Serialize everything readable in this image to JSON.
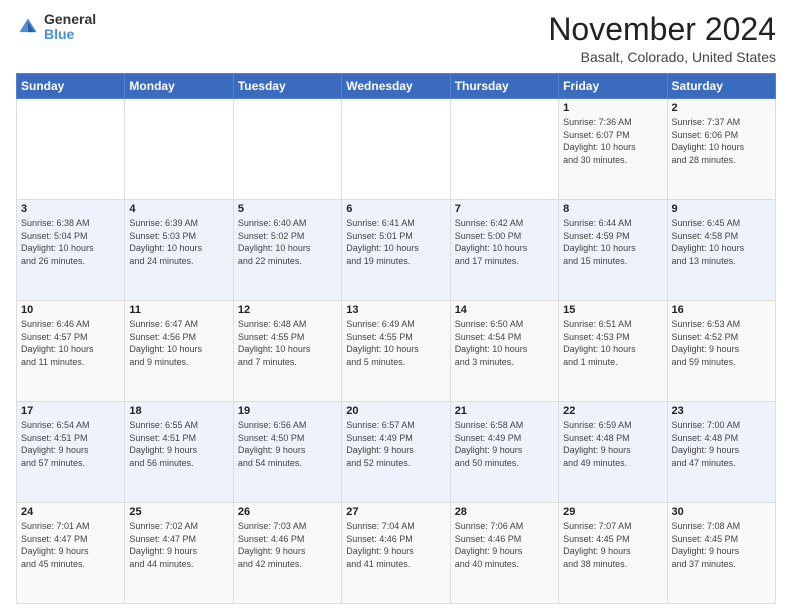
{
  "logo": {
    "general": "General",
    "blue": "Blue"
  },
  "title": "November 2024",
  "location": "Basalt, Colorado, United States",
  "days_of_week": [
    "Sunday",
    "Monday",
    "Tuesday",
    "Wednesday",
    "Thursday",
    "Friday",
    "Saturday"
  ],
  "weeks": [
    [
      {
        "day": "",
        "detail": ""
      },
      {
        "day": "",
        "detail": ""
      },
      {
        "day": "",
        "detail": ""
      },
      {
        "day": "",
        "detail": ""
      },
      {
        "day": "",
        "detail": ""
      },
      {
        "day": "1",
        "detail": "Sunrise: 7:36 AM\nSunset: 6:07 PM\nDaylight: 10 hours\nand 30 minutes."
      },
      {
        "day": "2",
        "detail": "Sunrise: 7:37 AM\nSunset: 6:06 PM\nDaylight: 10 hours\nand 28 minutes."
      }
    ],
    [
      {
        "day": "3",
        "detail": "Sunrise: 6:38 AM\nSunset: 5:04 PM\nDaylight: 10 hours\nand 26 minutes."
      },
      {
        "day": "4",
        "detail": "Sunrise: 6:39 AM\nSunset: 5:03 PM\nDaylight: 10 hours\nand 24 minutes."
      },
      {
        "day": "5",
        "detail": "Sunrise: 6:40 AM\nSunset: 5:02 PM\nDaylight: 10 hours\nand 22 minutes."
      },
      {
        "day": "6",
        "detail": "Sunrise: 6:41 AM\nSunset: 5:01 PM\nDaylight: 10 hours\nand 19 minutes."
      },
      {
        "day": "7",
        "detail": "Sunrise: 6:42 AM\nSunset: 5:00 PM\nDaylight: 10 hours\nand 17 minutes."
      },
      {
        "day": "8",
        "detail": "Sunrise: 6:44 AM\nSunset: 4:59 PM\nDaylight: 10 hours\nand 15 minutes."
      },
      {
        "day": "9",
        "detail": "Sunrise: 6:45 AM\nSunset: 4:58 PM\nDaylight: 10 hours\nand 13 minutes."
      }
    ],
    [
      {
        "day": "10",
        "detail": "Sunrise: 6:46 AM\nSunset: 4:57 PM\nDaylight: 10 hours\nand 11 minutes."
      },
      {
        "day": "11",
        "detail": "Sunrise: 6:47 AM\nSunset: 4:56 PM\nDaylight: 10 hours\nand 9 minutes."
      },
      {
        "day": "12",
        "detail": "Sunrise: 6:48 AM\nSunset: 4:55 PM\nDaylight: 10 hours\nand 7 minutes."
      },
      {
        "day": "13",
        "detail": "Sunrise: 6:49 AM\nSunset: 4:55 PM\nDaylight: 10 hours\nand 5 minutes."
      },
      {
        "day": "14",
        "detail": "Sunrise: 6:50 AM\nSunset: 4:54 PM\nDaylight: 10 hours\nand 3 minutes."
      },
      {
        "day": "15",
        "detail": "Sunrise: 6:51 AM\nSunset: 4:53 PM\nDaylight: 10 hours\nand 1 minute."
      },
      {
        "day": "16",
        "detail": "Sunrise: 6:53 AM\nSunset: 4:52 PM\nDaylight: 9 hours\nand 59 minutes."
      }
    ],
    [
      {
        "day": "17",
        "detail": "Sunrise: 6:54 AM\nSunset: 4:51 PM\nDaylight: 9 hours\nand 57 minutes."
      },
      {
        "day": "18",
        "detail": "Sunrise: 6:55 AM\nSunset: 4:51 PM\nDaylight: 9 hours\nand 56 minutes."
      },
      {
        "day": "19",
        "detail": "Sunrise: 6:56 AM\nSunset: 4:50 PM\nDaylight: 9 hours\nand 54 minutes."
      },
      {
        "day": "20",
        "detail": "Sunrise: 6:57 AM\nSunset: 4:49 PM\nDaylight: 9 hours\nand 52 minutes."
      },
      {
        "day": "21",
        "detail": "Sunrise: 6:58 AM\nSunset: 4:49 PM\nDaylight: 9 hours\nand 50 minutes."
      },
      {
        "day": "22",
        "detail": "Sunrise: 6:59 AM\nSunset: 4:48 PM\nDaylight: 9 hours\nand 49 minutes."
      },
      {
        "day": "23",
        "detail": "Sunrise: 7:00 AM\nSunset: 4:48 PM\nDaylight: 9 hours\nand 47 minutes."
      }
    ],
    [
      {
        "day": "24",
        "detail": "Sunrise: 7:01 AM\nSunset: 4:47 PM\nDaylight: 9 hours\nand 45 minutes."
      },
      {
        "day": "25",
        "detail": "Sunrise: 7:02 AM\nSunset: 4:47 PM\nDaylight: 9 hours\nand 44 minutes."
      },
      {
        "day": "26",
        "detail": "Sunrise: 7:03 AM\nSunset: 4:46 PM\nDaylight: 9 hours\nand 42 minutes."
      },
      {
        "day": "27",
        "detail": "Sunrise: 7:04 AM\nSunset: 4:46 PM\nDaylight: 9 hours\nand 41 minutes."
      },
      {
        "day": "28",
        "detail": "Sunrise: 7:06 AM\nSunset: 4:46 PM\nDaylight: 9 hours\nand 40 minutes."
      },
      {
        "day": "29",
        "detail": "Sunrise: 7:07 AM\nSunset: 4:45 PM\nDaylight: 9 hours\nand 38 minutes."
      },
      {
        "day": "30",
        "detail": "Sunrise: 7:08 AM\nSunset: 4:45 PM\nDaylight: 9 hours\nand 37 minutes."
      }
    ]
  ]
}
